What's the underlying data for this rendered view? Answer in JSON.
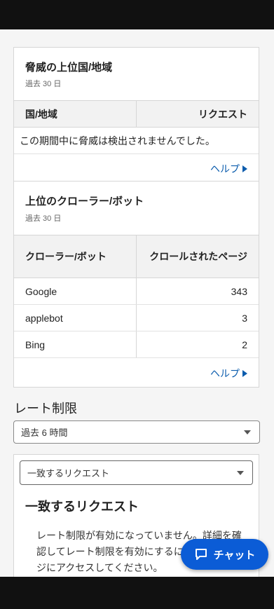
{
  "threats_card": {
    "title": "脅威の上位国/地域",
    "subtitle": "過去 30 日",
    "columns": [
      "国/地域",
      "リクエスト"
    ],
    "empty_message": "この期間中に脅威は検出されませんでした。",
    "help_label": "ヘルプ"
  },
  "crawlers_card": {
    "title": "上位のクローラー/ボット",
    "subtitle": "過去 30 日",
    "columns": [
      "クローラー/ボット",
      "クロールされたページ"
    ],
    "rows": [
      {
        "name": "Google",
        "pages": "343"
      },
      {
        "name": "applebot",
        "pages": "3"
      },
      {
        "name": "Bing",
        "pages": "2"
      }
    ],
    "help_label": "ヘルプ"
  },
  "rate_limit": {
    "title": "レート制限",
    "period_select": "過去 6 時間",
    "filter_select": "一致するリクエスト",
    "panel_title": "一致するリクエスト",
    "message": "レート制限が有効になっていません。詳細を確認してレート制限を有効にするには、次のページにアクセスしてください。"
  },
  "chat_button": {
    "label": "チャット"
  }
}
